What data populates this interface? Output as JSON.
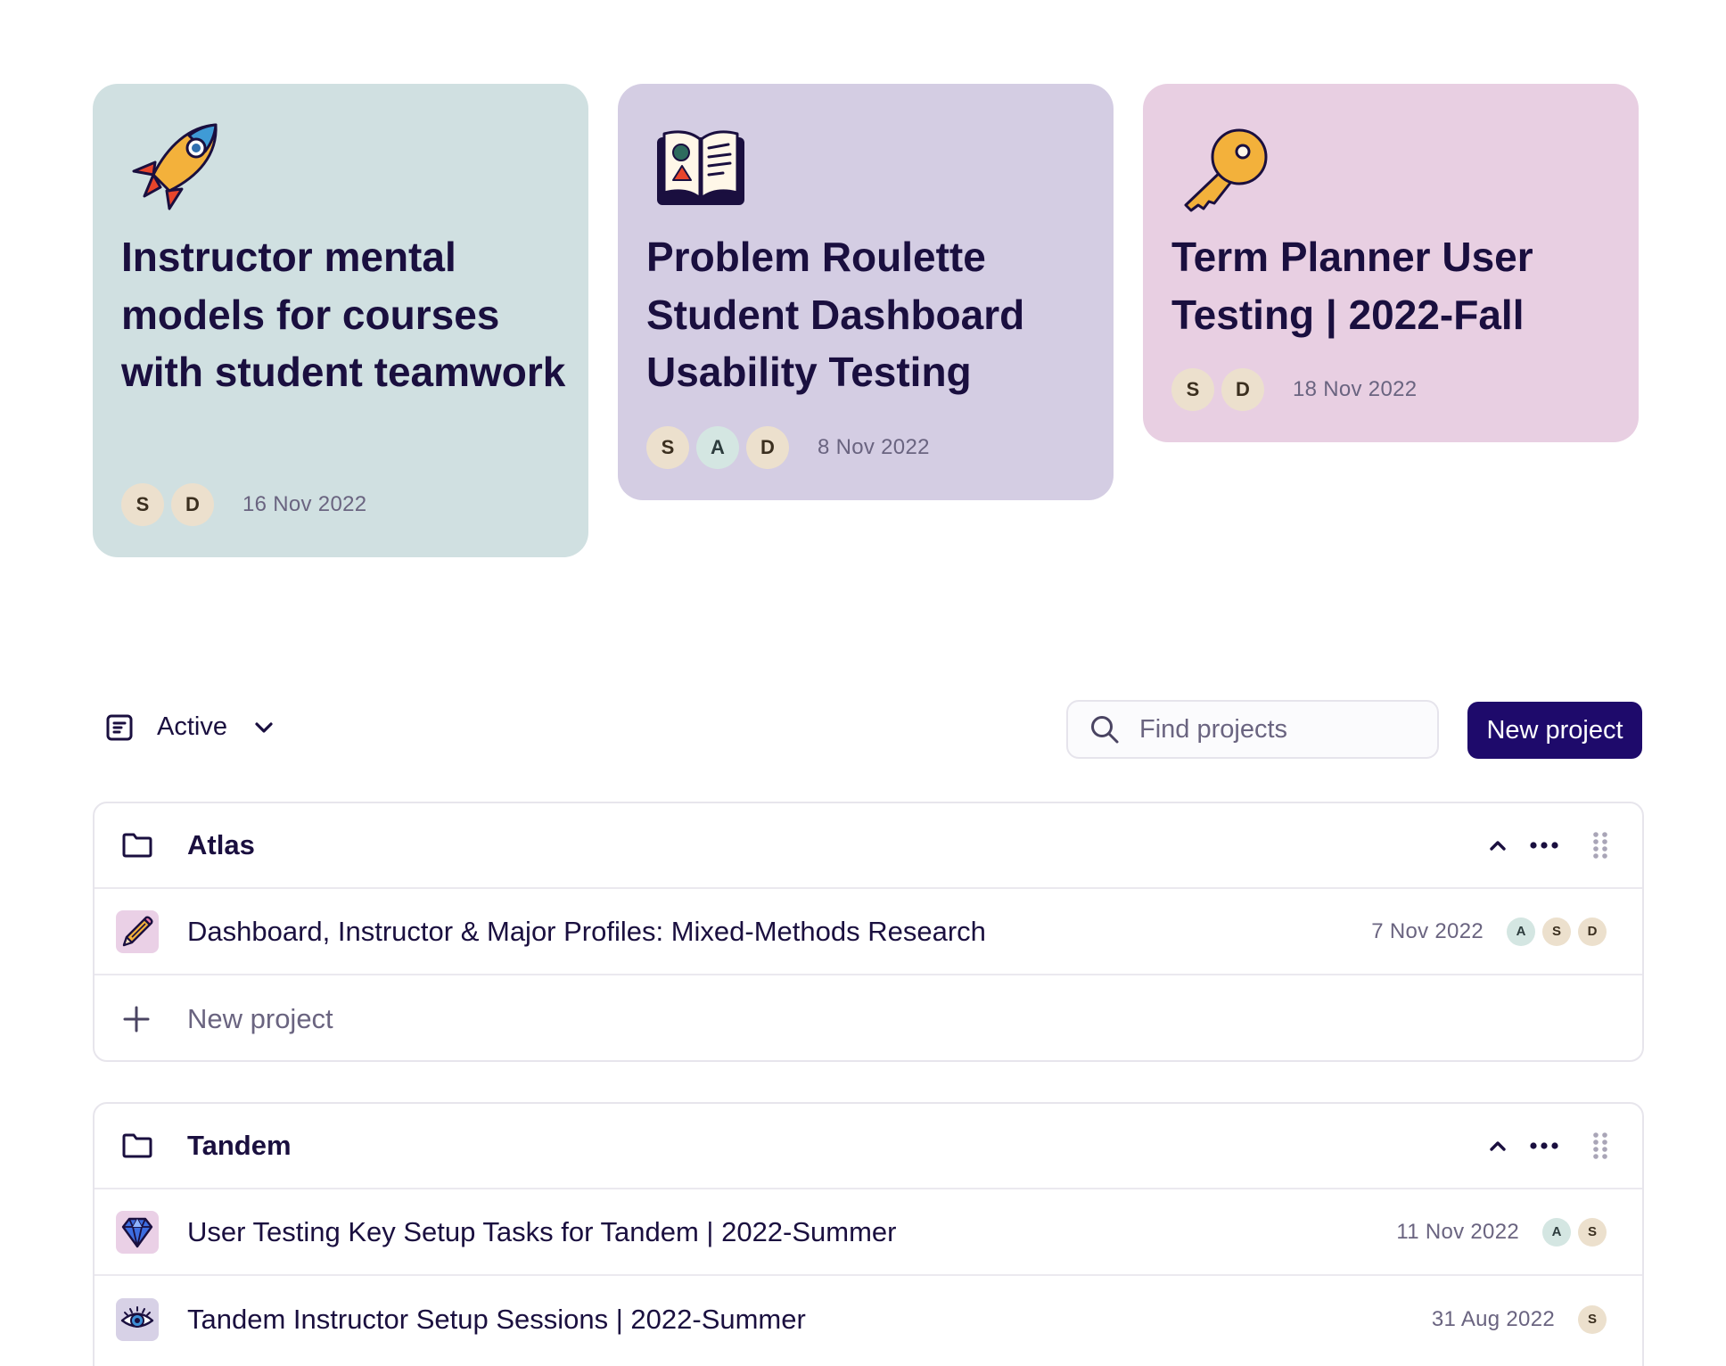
{
  "pinned": [
    {
      "icon": "rocket-icon",
      "title": "Instructor mental models for courses with student teamwork",
      "collaborators": [
        "S",
        "D"
      ],
      "date": "16 Nov 2022",
      "color": "#d0e0e1"
    },
    {
      "icon": "open-book-icon",
      "title": "Problem Roulette Student Dashboard Usability Testing",
      "collaborators": [
        "S",
        "A",
        "D"
      ],
      "date": "8 Nov 2022",
      "color": "#d4cde3"
    },
    {
      "icon": "key-icon",
      "title": "Term Planner User Testing | 2022-Fall",
      "collaborators": [
        "S",
        "D"
      ],
      "date": "18 Nov 2022",
      "color": "#e8cfe2"
    }
  ],
  "toolbar": {
    "filter_label": "Active",
    "search_placeholder": "Find projects",
    "new_project_label": "New project"
  },
  "groups": [
    {
      "name": "Atlas",
      "projects": [
        {
          "icon": "pencil-icon",
          "icon_bg": "#ead0e6",
          "title": "Dashboard, Instructor & Major Profiles: Mixed-Methods Research",
          "date": "7 Nov 2022",
          "collaborators": [
            "A",
            "S",
            "D"
          ]
        }
      ],
      "add_label": "New project"
    },
    {
      "name": "Tandem",
      "projects": [
        {
          "icon": "diamond-icon",
          "icon_bg": "#ead0e6",
          "title": "User Testing Key Setup Tasks for Tandem | 2022-Summer",
          "date": "11 Nov 2022",
          "collaborators": [
            "A",
            "S"
          ]
        },
        {
          "icon": "eye-icon",
          "icon_bg": "#d7d1e6",
          "title": "Tandem Instructor Setup Sessions | 2022-Summer",
          "date": "31 Aug 2022",
          "collaborators": [
            "S"
          ]
        }
      ]
    }
  ],
  "colors": {
    "primary": "#1e0a6b",
    "text": "#1a0f3f",
    "muted": "#6a6480"
  }
}
